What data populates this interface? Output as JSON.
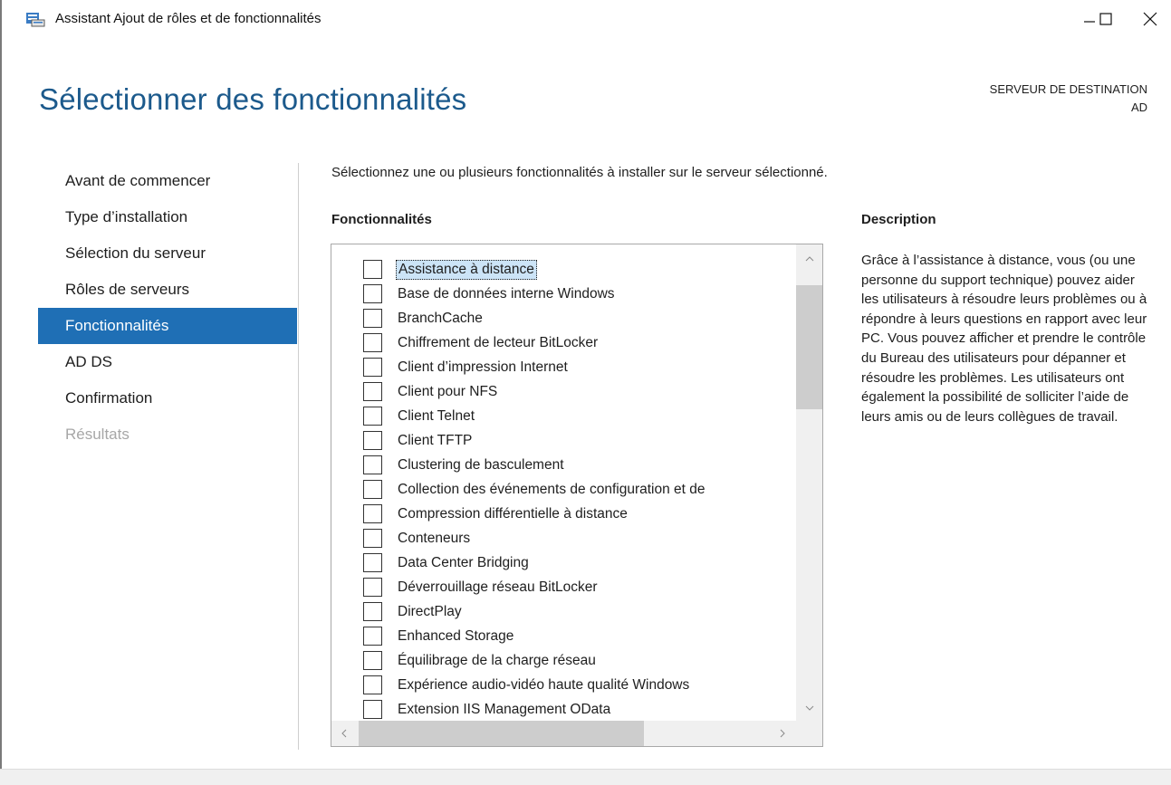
{
  "window": {
    "title": "Assistant Ajout de rôles et de fonctionnalités",
    "controls": [
      "minimize",
      "maximize",
      "close"
    ]
  },
  "header": {
    "page_title": "Sélectionner des fonctionnalités",
    "destination_label": "SERVEUR DE DESTINATION",
    "destination_server": "AD"
  },
  "nav": {
    "items": [
      {
        "label": "Avant de commencer",
        "state": "normal"
      },
      {
        "label": "Type d’installation",
        "state": "normal"
      },
      {
        "label": "Sélection du serveur",
        "state": "normal"
      },
      {
        "label": "Rôles de serveurs",
        "state": "normal"
      },
      {
        "label": "Fonctionnalités",
        "state": "active"
      },
      {
        "label": "AD DS",
        "state": "normal"
      },
      {
        "label": "Confirmation",
        "state": "normal"
      },
      {
        "label": "Résultats",
        "state": "disabled"
      }
    ]
  },
  "main": {
    "instruction": "Sélectionnez une ou plusieurs fonctionnalités à installer sur le serveur sélectionné.",
    "features_heading": "Fonctionnalités",
    "features": [
      {
        "label": "Assistance à distance",
        "checked": false,
        "selected": true
      },
      {
        "label": "Base de données interne Windows",
        "checked": false
      },
      {
        "label": "BranchCache",
        "checked": false
      },
      {
        "label": "Chiffrement de lecteur BitLocker",
        "checked": false
      },
      {
        "label": "Client d’impression Internet",
        "checked": false
      },
      {
        "label": "Client pour NFS",
        "checked": false
      },
      {
        "label": "Client Telnet",
        "checked": false
      },
      {
        "label": "Client TFTP",
        "checked": false
      },
      {
        "label": "Clustering de basculement",
        "checked": false
      },
      {
        "label": "Collection des événements de configuration et de",
        "checked": false
      },
      {
        "label": "Compression différentielle à distance",
        "checked": false
      },
      {
        "label": "Conteneurs",
        "checked": false
      },
      {
        "label": "Data Center Bridging",
        "checked": false
      },
      {
        "label": "Déverrouillage réseau BitLocker",
        "checked": false
      },
      {
        "label": "DirectPlay",
        "checked": false
      },
      {
        "label": "Enhanced Storage",
        "checked": false
      },
      {
        "label": "Équilibrage de la charge réseau",
        "checked": false
      },
      {
        "label": "Expérience audio-vidéo haute qualité Windows",
        "checked": false
      },
      {
        "label": "Extension IIS Management OData",
        "checked": false
      }
    ],
    "description_heading": "Description",
    "description_text": "Grâce à l’assistance à distance, vous (ou une personne du support technique) pouvez aider les utilisateurs à résoudre leurs problèmes ou à répondre à leurs questions en rapport avec leur PC. Vous pouvez afficher et prendre le contrôle du Bureau des utilisateurs pour dépanner et résoudre les problèmes. Les utilisateurs ont également la possibilité de solliciter l’aide de leurs amis ou de leurs collègues de travail."
  },
  "colors": {
    "title_blue": "#1c5a8c",
    "nav_active": "#1f6fb5",
    "selection": "#cce4f7"
  }
}
